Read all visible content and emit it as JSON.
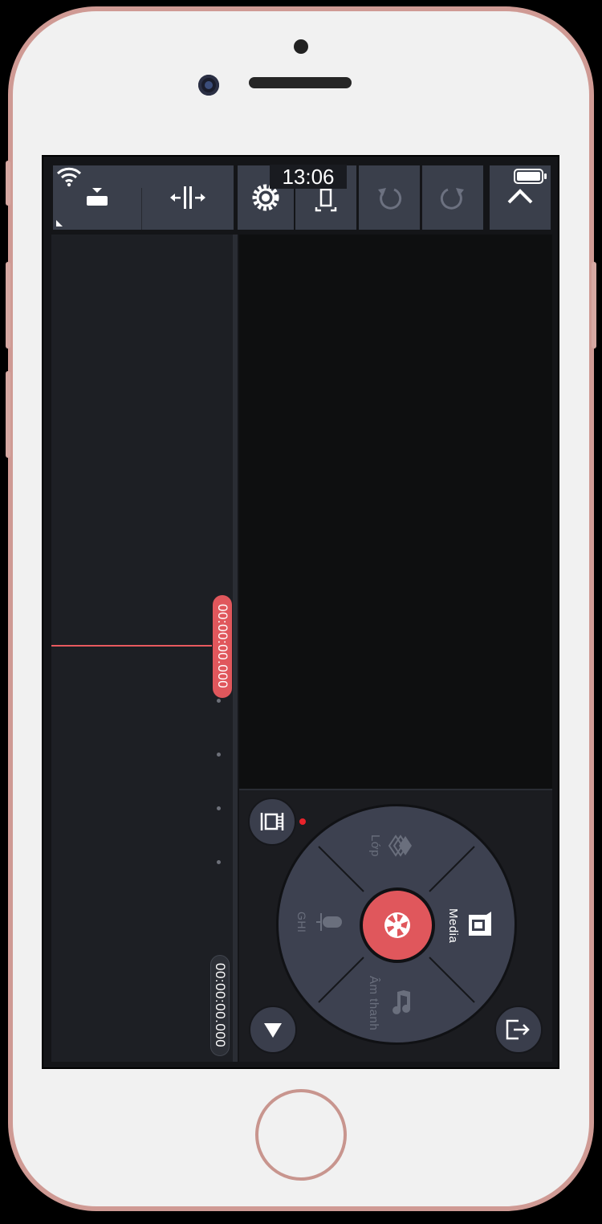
{
  "status_bar": {
    "time": "13:06",
    "wifi_icon": "wifi-icon",
    "battery_icon": "battery-icon"
  },
  "toolbar": {
    "left_icons": [
      "media-browser-icon",
      "split-icon"
    ],
    "right_icons": [
      "settings-icon",
      "aspect-ratio-icon",
      "undo-icon",
      "redo-icon",
      "chevron-up-icon"
    ]
  },
  "timeline": {
    "playhead_time": "00:00:00.000",
    "total_duration": "00:00:00.000"
  },
  "wheel": {
    "layer_label": "Lớp",
    "media_label": "Media",
    "audio_label": "Âm thanh",
    "record_label": "Ghi",
    "center_icon": "camera-shutter-icon"
  },
  "buttons": {
    "crop_icon": "crop-expand-icon",
    "collapse_icon": "triangle-down-icon",
    "export_icon": "export-icon"
  },
  "colors": {
    "accent": "#e0575c",
    "panel": "#3a3f4b",
    "background": "#141518"
  }
}
